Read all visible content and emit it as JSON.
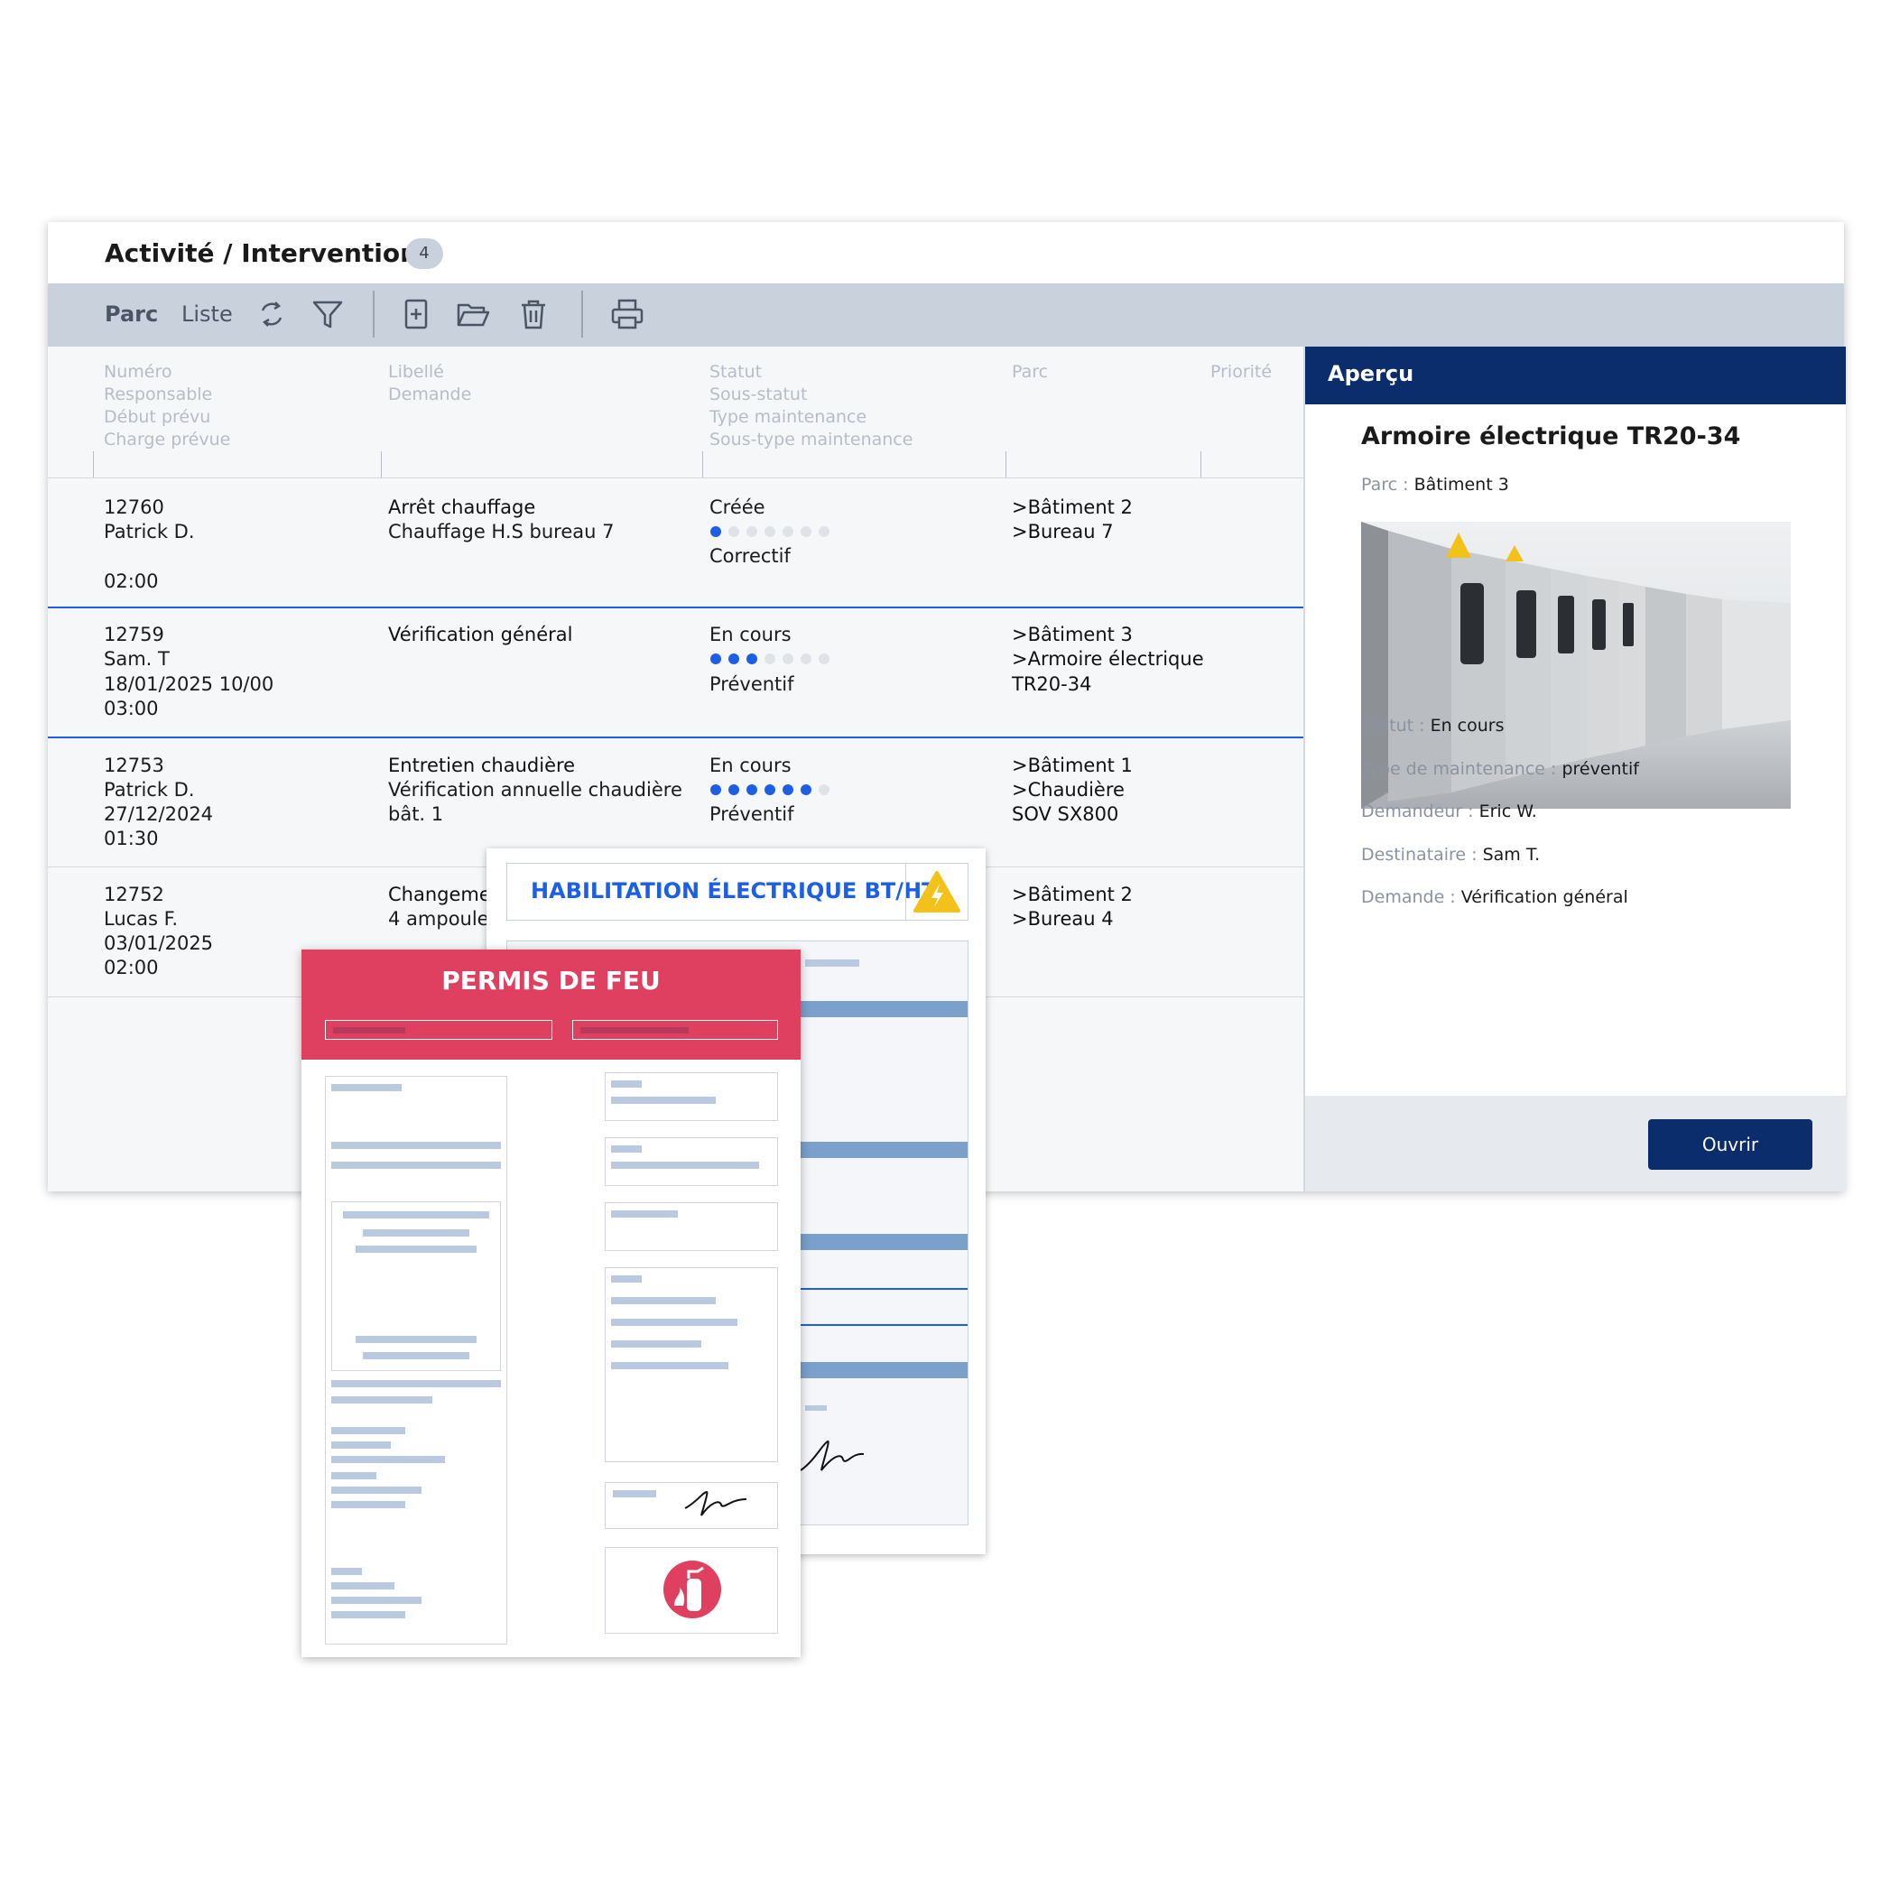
{
  "header": {
    "title": "Activité / Interventions",
    "count": "4"
  },
  "toolbar": {
    "tabs": [
      "Parc",
      "Liste"
    ],
    "icons": [
      "refresh-icon",
      "filter-icon",
      "add-icon",
      "open-folder-icon",
      "trash-icon",
      "print-icon"
    ]
  },
  "columns": {
    "c1": "Numéro\nResponsable\nDébut prévu\nCharge prévue",
    "c2": "Libellé\nDemande",
    "c3": "Statut\nSous-statut\nType maintenance\nSous-type maintenance",
    "c4": "Parc",
    "c5": "Priorité"
  },
  "rows": [
    {
      "numero": "12760",
      "responsable": "Patrick D.",
      "debut": "",
      "charge": "02:00",
      "libelle": "Arrêt chauffage",
      "demande": "Chauffage H.S bureau 7",
      "statut": "Créée",
      "progress": 1,
      "type": "Correctif",
      "parc1": ">Bâtiment 2",
      "parc2": ">Bureau 7",
      "parc3": ""
    },
    {
      "numero": "12759",
      "responsable": "Sam. T",
      "debut": "18/01/2025 10/00",
      "charge": "03:00",
      "libelle": "Vérification général",
      "demande": "",
      "statut": "En cours",
      "progress": 3,
      "type": "Préventif",
      "parc1": ">Bâtiment 3",
      "parc2": ">Armoire électrique",
      "parc3": "TR20-34"
    },
    {
      "numero": "12753",
      "responsable": "Patrick D.",
      "debut": "27/12/2024",
      "charge": "01:30",
      "libelle": "Entretien chaudière",
      "demande": "Vérification annuelle chaudière",
      "demande2": "bât. 1",
      "statut": "En cours",
      "progress": 6,
      "type": "Préventif",
      "parc1": ">Bâtiment 1",
      "parc2": ">Chaudière",
      "parc3": "SOV SX800"
    },
    {
      "numero": "12752",
      "responsable": "Lucas F.",
      "debut": "03/01/2025",
      "charge": "02:00",
      "libelle": "Changeme",
      "demande": "4 ampoule",
      "statut": "",
      "progress": 0,
      "type": "",
      "parc1": ">Bâtiment 2",
      "parc2": ">Bureau 4",
      "parc3": ""
    }
  ],
  "progress_total": 7,
  "preview": {
    "header": "Aperçu",
    "title": "Armoire électrique TR20-34",
    "parc_label": "Parc :",
    "parc_value": "Bâtiment 3",
    "statut_label": "Statut :",
    "statut_value": "En cours",
    "type_label": "Type de maintenance :",
    "type_value": "préventif",
    "demandeur_label": "Demandeur :",
    "demandeur_value": "Eric W.",
    "destinataire_label": "Destinataire :",
    "destinataire_value": "Sam T.",
    "demande_label": "Demande :",
    "demande_value": "Vérification général",
    "open_button": "Ouvrir"
  },
  "documents": {
    "electrical": "HABILITATION ÉLECTRIQUE BT/HT",
    "fire": "PERMIS DE FEU"
  },
  "colors": {
    "accent": "#1c5fe6",
    "navy": "#0b2d6b",
    "fire": "#e04060",
    "toolbar": "#c9d1dc"
  }
}
